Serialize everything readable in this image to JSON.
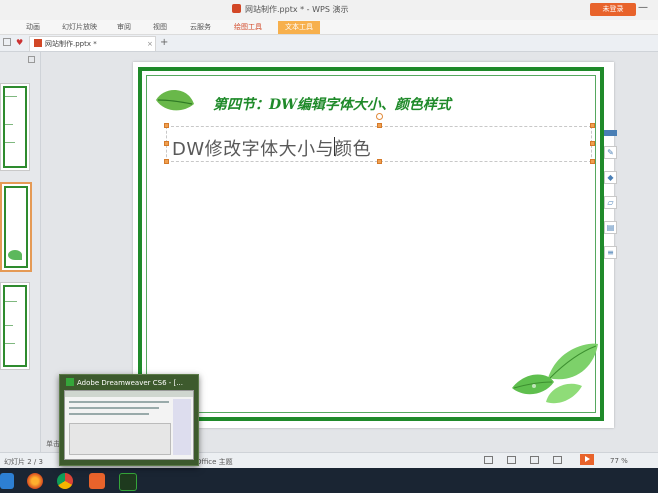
{
  "window": {
    "title": "网站制作.pptx * - WPS 演示",
    "login_button": "未登录"
  },
  "ribbon": {
    "tabs": [
      "动画",
      "幻灯片放映",
      "审阅",
      "视图",
      "云服务",
      "绘图工具",
      "文本工具"
    ],
    "active_context_tab": "文本工具"
  },
  "doc_tabs": {
    "active": "网站制作.pptx *",
    "add_label": "+"
  },
  "slide": {
    "title": "第四节：DW编辑字体大小、颜色样式",
    "textbox_text": "DW修改字体大小与颜色"
  },
  "status": {
    "page": "幻灯片 2 / 3",
    "theme": "Office 主题",
    "zoom": "77 %",
    "notes_placeholder": "单击此处添加备注"
  },
  "taskbar": {
    "preview_title": "Adobe Dreamweaver CS6 - [..."
  },
  "colors": {
    "accent": "#d24726",
    "slide_border": "#1f8a2a",
    "login_bg": "#e8632b"
  }
}
